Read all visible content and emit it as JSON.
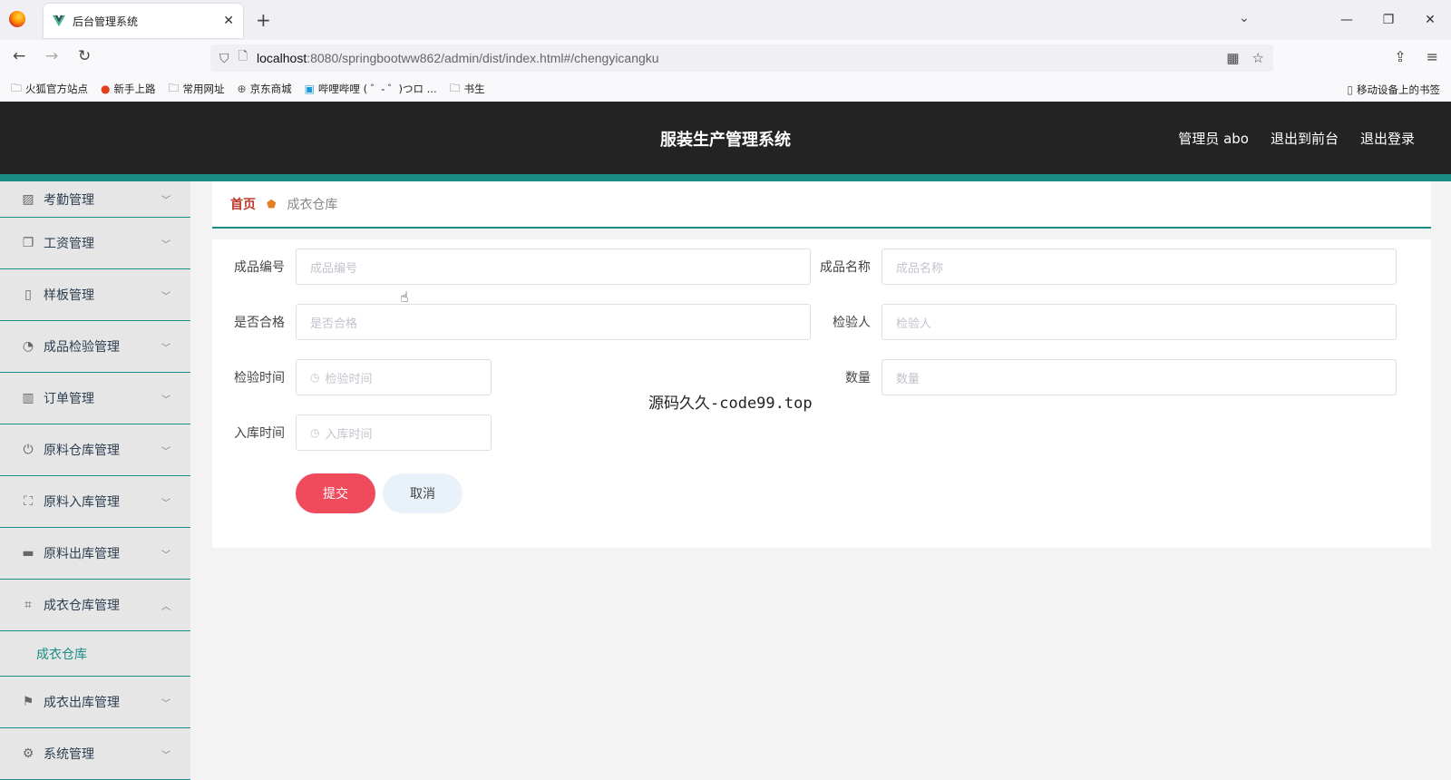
{
  "browser": {
    "tab_title": "后台管理系统",
    "tab_close": "✕",
    "new_tab": "+",
    "url_host": "localhost",
    "url_path": ":8080/springbootww862/admin/dist/index.html#/chengyicangku",
    "window_controls": [
      "—",
      "❐",
      "✕"
    ],
    "bookmarks": [
      {
        "icon": "folder-icon",
        "label": "火狐官方站点"
      },
      {
        "icon": "firefox-icon",
        "label": "新手上路"
      },
      {
        "icon": "folder-icon",
        "label": "常用网址"
      },
      {
        "icon": "globe-icon",
        "label": "京东商城"
      },
      {
        "icon": "bilibili-icon",
        "label": "哔哩哔哩 ( ゜- ゜)つロ ..."
      },
      {
        "icon": "folder-icon",
        "label": "书生"
      }
    ],
    "mobile_bookmarks": "移动设备上的书签"
  },
  "header": {
    "title": "服装生产管理系统",
    "admin_label": "管理员 abo",
    "to_frontend": "退出到前台",
    "logout": "退出登录"
  },
  "sidebar": {
    "items": [
      {
        "label": "考勤管理",
        "icon": "chart-icon",
        "chevron": "﹀"
      },
      {
        "label": "工资管理",
        "icon": "copy-icon",
        "chevron": "﹀"
      },
      {
        "label": "样板管理",
        "icon": "mobile-icon",
        "chevron": "﹀"
      },
      {
        "label": "成品检验管理",
        "icon": "compass-icon",
        "chevron": "﹀"
      },
      {
        "label": "订单管理",
        "icon": "data-icon",
        "chevron": "﹀"
      },
      {
        "label": "原料仓库管理",
        "icon": "power-icon",
        "chevron": "﹀"
      },
      {
        "label": "原料入库管理",
        "icon": "scan-icon",
        "chevron": "﹀"
      },
      {
        "label": "原料出库管理",
        "icon": "ticket-icon",
        "chevron": "﹀"
      },
      {
        "label": "成衣仓库管理",
        "icon": "crop-icon",
        "chevron": "︿"
      },
      {
        "label": "成衣出库管理",
        "icon": "flag-icon",
        "chevron": "﹀"
      },
      {
        "label": "系统管理",
        "icon": "settings-icon",
        "chevron": "﹀"
      }
    ],
    "submenu_label": "成衣仓库"
  },
  "breadcrumb": {
    "home": "首页",
    "current": "成衣仓库"
  },
  "form": {
    "product_code_label": "成品编号",
    "product_code_placeholder": "成品编号",
    "product_name_label": "成品名称",
    "product_name_placeholder": "成品名称",
    "qualified_label": "是否合格",
    "qualified_placeholder": "是否合格",
    "inspector_label": "检验人",
    "inspector_placeholder": "检验人",
    "inspect_time_label": "检验时间",
    "inspect_time_placeholder": "检验时间",
    "quantity_label": "数量",
    "quantity_placeholder": "数量",
    "stockin_time_label": "入库时间",
    "stockin_time_placeholder": "入库时间",
    "submit": "提交",
    "cancel": "取消"
  },
  "caption": "源码久久-code99.top",
  "colors": {
    "accent": "#1a8d84",
    "header_bg": "#232323",
    "submit_bg": "#f04a5d",
    "crumb_home": "#c0392b"
  }
}
